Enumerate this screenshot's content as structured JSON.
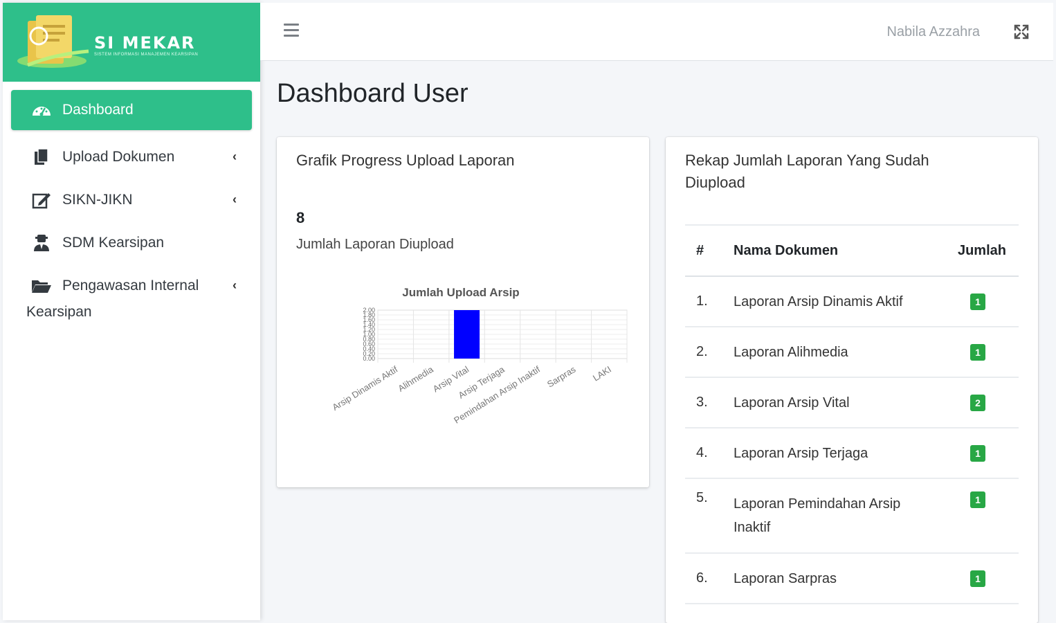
{
  "brand": {
    "name": "SI MEKAR",
    "subtitle": "SISTEM INFORMASI MANAJEMEN KEARSIPAN",
    "accent_color": "#2ebf8a"
  },
  "sidebar": {
    "items": [
      {
        "label": "Dashboard",
        "icon": "gauge-icon",
        "active": true
      },
      {
        "label": "Upload Dokumen",
        "icon": "files-icon",
        "chevron": "‹"
      },
      {
        "label": "SIKN-JIKN",
        "icon": "edit-icon",
        "chevron": "‹"
      },
      {
        "label": "SDM Kearsipan",
        "icon": "user-tie-icon"
      },
      {
        "label": "Pengawasan Internal",
        "label_cont": "Kearsipan",
        "icon": "folder-open-icon",
        "chevron": "‹"
      }
    ]
  },
  "topbar": {
    "menu_icon": "hamburger-icon",
    "username": "Nabila Azzahra",
    "fullscreen_icon": "expand-icon"
  },
  "page": {
    "title": "Dashboard User"
  },
  "left_card": {
    "title": "Grafik Progress Upload Laporan",
    "stat_value": "8",
    "stat_label": "Jumlah Laporan Diupload"
  },
  "chart_data": {
    "type": "bar",
    "title": "Jumlah Upload Arsip",
    "categories": [
      "Arsip Dinamis Aktif",
      "Alihmedia",
      "Arsip Vital",
      "Arsip Terjaga",
      "Pemindahan Arsip Inaktif",
      "Sarpras",
      "LAKI"
    ],
    "values": [
      0,
      0,
      2,
      0,
      0,
      0,
      0
    ],
    "ylim": [
      0,
      2
    ],
    "bar_color": "#0000ff",
    "grid": true
  },
  "right_card": {
    "title": "Rekap Jumlah Laporan Yang Sudah Diupload",
    "table": {
      "headers": [
        "#",
        "Nama Dokumen",
        "Jumlah"
      ],
      "rows": [
        {
          "no": "1.",
          "name": "Laporan Arsip Dinamis Aktif",
          "qty": "1"
        },
        {
          "no": "2.",
          "name": "Laporan Alihmedia",
          "qty": "1"
        },
        {
          "no": "3.",
          "name": "Laporan Arsip Vital",
          "qty": "2"
        },
        {
          "no": "4.",
          "name": "Laporan Arsip Terjaga",
          "qty": "1"
        },
        {
          "no": "5.",
          "name": "Laporan Pemindahan Arsip Inaktif",
          "qty": "1"
        },
        {
          "no": "6.",
          "name": "Laporan Sarpras",
          "qty": "1"
        }
      ]
    },
    "badge_color": "#28a745"
  }
}
